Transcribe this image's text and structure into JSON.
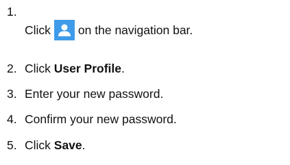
{
  "steps": [
    {
      "number": "1.",
      "before": "Click",
      "icon": "user-profile-icon",
      "after": "on the navigation bar."
    },
    {
      "number": "2.",
      "before": "Click ",
      "bold": "User Profile",
      "after": "."
    },
    {
      "number": "3.",
      "text": "Enter your new password."
    },
    {
      "number": "4.",
      "text": "Confirm your new password."
    },
    {
      "number": "5.",
      "before": "Click ",
      "bold": "Save",
      "after": "."
    }
  ],
  "colors": {
    "icon_background": "#3f9bea",
    "icon_foreground": "#ffffff",
    "text": "#111111"
  }
}
